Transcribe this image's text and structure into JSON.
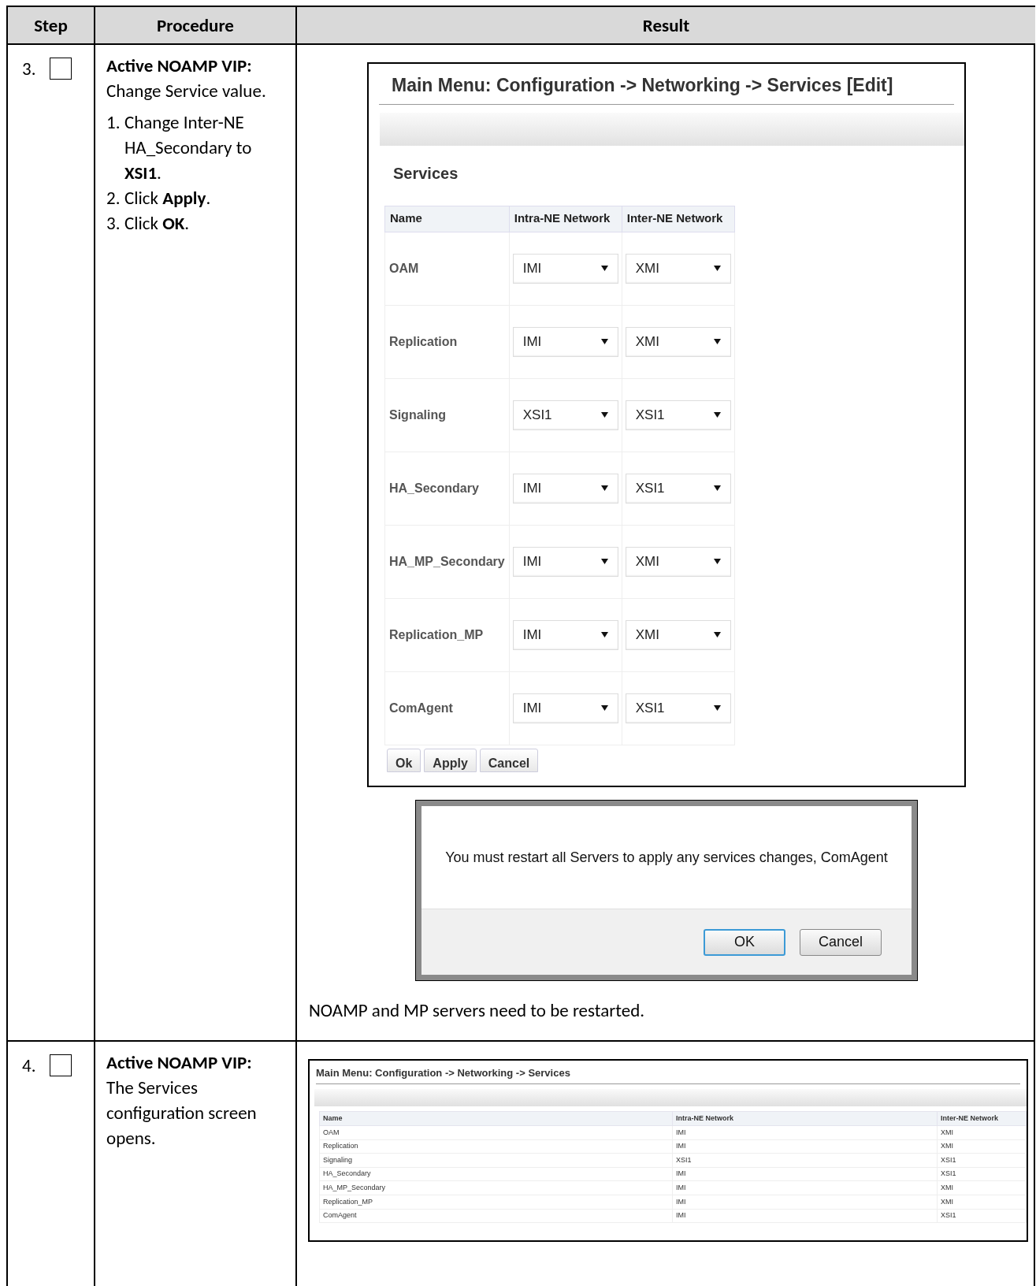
{
  "columns": [
    "Step",
    "Procedure",
    "Result"
  ],
  "steps": [
    {
      "number": "3.",
      "checked": false,
      "heading": "Active NOAMP VIP:",
      "intro": "Change Service value.",
      "instructions": [
        {
          "number": "1.",
          "text": "Change Inter-NE HA_Secondary to **XSI1**."
        },
        {
          "number": "2.",
          "text": "Click **Apply**."
        },
        {
          "number": "3.",
          "text": "Click **OK**."
        }
      ],
      "edit_screen": {
        "title": "Main Menu: Configuration -> Networking -> Services [Edit]",
        "section": "Services",
        "columns": [
          "Name",
          "Intra-NE Network",
          "Inter-NE Network"
        ],
        "rows": [
          {
            "name": "OAM",
            "intra": "IMI",
            "inter": "XMI"
          },
          {
            "name": "Replication",
            "intra": "IMI",
            "inter": "XMI"
          },
          {
            "name": "Signaling",
            "intra": "XSI1",
            "inter": "XSI1"
          },
          {
            "name": "HA_Secondary",
            "intra": "IMI",
            "inter": "XSI1"
          },
          {
            "name": "HA_MP_Secondary",
            "intra": "IMI",
            "inter": "XMI"
          },
          {
            "name": "Replication_MP",
            "intra": "IMI",
            "inter": "XMI"
          },
          {
            "name": "ComAgent",
            "intra": "IMI",
            "inter": "XSI1"
          }
        ],
        "buttons": [
          "Ok",
          "Apply",
          "Cancel"
        ]
      },
      "dialog": {
        "message": "You must restart all Servers to apply any services changes, ComAgent",
        "buttons": [
          {
            "label": "OK",
            "focused": true
          },
          {
            "label": "Cancel",
            "focused": false
          }
        ]
      },
      "note": "NOAMP and MP servers need to be restarted."
    },
    {
      "number": "4.",
      "checked": false,
      "heading": "Active NOAMP VIP:",
      "intro": "The Services configuration screen opens.",
      "view_screen": {
        "title": "Main Menu: Configuration -> Networking -> Services",
        "columns": [
          "Name",
          "Intra-NE Network",
          "Inter-NE Network"
        ],
        "rows": [
          {
            "name": "OAM",
            "intra": "IMI",
            "inter": "XMI"
          },
          {
            "name": "Replication",
            "intra": "IMI",
            "inter": "XMI"
          },
          {
            "name": "Signaling",
            "intra": "XSI1",
            "inter": "XSI1"
          },
          {
            "name": "HA_Secondary",
            "intra": "IMI",
            "inter": "XSI1"
          },
          {
            "name": "HA_MP_Secondary",
            "intra": "IMI",
            "inter": "XMI"
          },
          {
            "name": "Replication_MP",
            "intra": "IMI",
            "inter": "XMI"
          },
          {
            "name": "ComAgent",
            "intra": "IMI",
            "inter": "XSI1"
          }
        ]
      }
    }
  ]
}
